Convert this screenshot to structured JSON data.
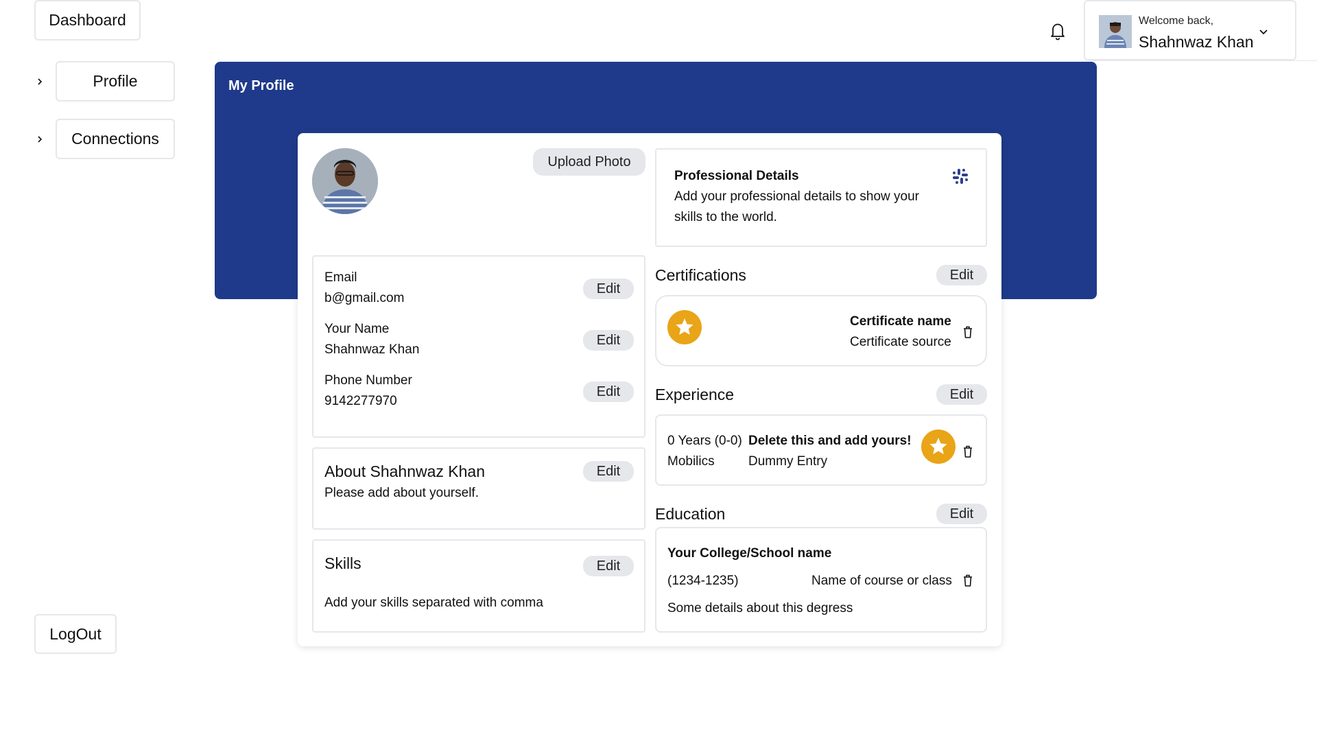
{
  "sidebar": {
    "dashboard": "Dashboard",
    "items": [
      {
        "label": "Profile"
      },
      {
        "label": "Connections"
      }
    ],
    "logout": "LogOut"
  },
  "header": {
    "welcome": "Welcome back,",
    "user_name": "Shahnwaz Khan"
  },
  "banner": {
    "title": "My Profile"
  },
  "profile": {
    "upload_photo": "Upload Photo",
    "fields": [
      {
        "label": "Email",
        "value": "b@gmail.com",
        "action": "Edit"
      },
      {
        "label": "Your Name",
        "value": "Shahnwaz Khan",
        "action": "Edit"
      },
      {
        "label": "Phone Number",
        "value": "9142277970",
        "action": "Edit"
      }
    ],
    "about": {
      "title": "About Shahnwaz Khan",
      "text": "Please add about yourself.",
      "action": "Edit"
    },
    "skills": {
      "title": "Skills",
      "text": "Add your skills separated with comma",
      "action": "Edit"
    }
  },
  "professional": {
    "title": "Professional Details",
    "text_line1": "Add your professional details to show your",
    "text_line2": "skills to the world."
  },
  "certifications": {
    "title": "Certifications",
    "action": "Edit",
    "item": {
      "name": "Certificate name",
      "source": "Certificate source"
    }
  },
  "experience": {
    "title": "Experience",
    "action": "Edit",
    "item": {
      "years": "0 Years (0-0)",
      "company": "Mobilics",
      "role": "Delete this and add yours!",
      "desc": "Dummy Entry"
    }
  },
  "education": {
    "title": "Education",
    "action": "Edit",
    "item": {
      "school": "Your College/School name",
      "years": "(1234-1235)",
      "course": "Name of course or class",
      "details": "Some details about this degress"
    }
  },
  "colors": {
    "banner": "#1f3a8a",
    "badge": "#e9a417",
    "pill": "#e5e7eb"
  },
  "icons": [
    "bell-icon",
    "chevron-right-icon",
    "chevron-down-icon",
    "star-icon",
    "trash-icon",
    "slack-icon"
  ]
}
